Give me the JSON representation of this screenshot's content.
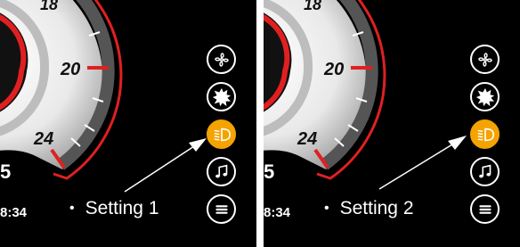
{
  "panels": [
    {
      "caption": "Setting 1",
      "gauge_labels": [
        "18",
        "20",
        "24"
      ],
      "time": "8:34",
      "partial_digit": "5",
      "icons": [
        "fan-icon",
        "sun-icon",
        "headlight-icon",
        "music-icon",
        "menu-icon"
      ],
      "active_icon": "headlight-icon"
    },
    {
      "caption": "Setting 2",
      "gauge_labels": [
        "18",
        "20",
        "24"
      ],
      "time": "8:34",
      "partial_digit": "5",
      "icons": [
        "fan-icon",
        "sun-icon",
        "headlight-icon",
        "music-icon",
        "menu-icon"
      ],
      "active_icon": "headlight-icon"
    }
  ],
  "colors": {
    "background": "#000000",
    "accent_red": "#e02020",
    "active_orange": "#f5a300",
    "divider": "#ffffff"
  }
}
